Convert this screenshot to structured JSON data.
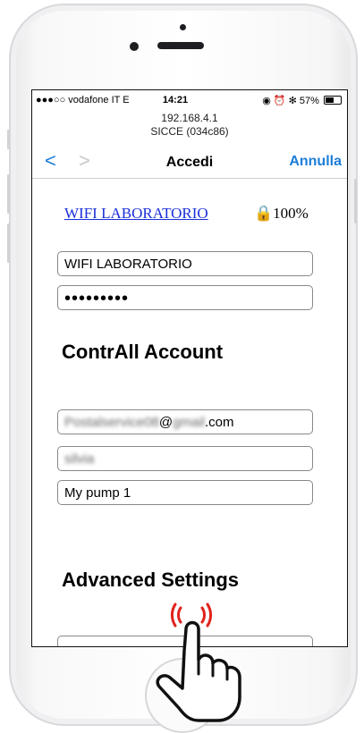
{
  "status_bar": {
    "carrier": "●●●○○ vodafone IT  E",
    "time": "14:21",
    "right": "◉ ⏰ ✻ 57%"
  },
  "address": {
    "ip": "192.168.4.1",
    "device": "SICCE (034c86)"
  },
  "nav": {
    "back_glyph": "<",
    "forward_glyph": ">",
    "title": "Accedi",
    "cancel_label": "Annulla"
  },
  "network": {
    "name": "WIFI LABORATORIO",
    "signal_text": "🔒100%"
  },
  "form": {
    "ssid_value": "WIFI LABORATORIO",
    "password_value": "•••••••••",
    "account_title": "ContrAll Account",
    "email_blurred": "Postalservice08",
    "email_mid": "@",
    "email_blurred2": "gmail",
    "email_suffix": ".com",
    "username_blurred": "silvia",
    "device_name_value": "My pump 1",
    "advanced_title": "Advanced Settings"
  }
}
